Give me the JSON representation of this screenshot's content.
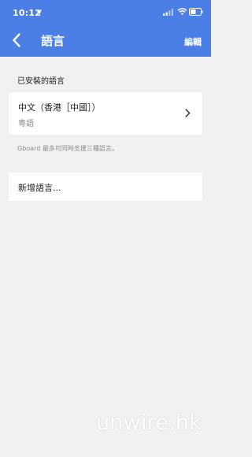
{
  "status_bar": {
    "time": "10:12"
  },
  "header": {
    "title": "語言",
    "edit_label": "編輯",
    "back_icon": "chevron-left-icon",
    "background_color": "#4c7fe6"
  },
  "installed_section": {
    "heading": "已安裝的語言",
    "languages": [
      {
        "name": "中文（香港［中國］）",
        "variant": "粵語"
      }
    ]
  },
  "support_note": "Gboard 最多可同時支援三種語言。",
  "add_language": {
    "label": "新增語言..."
  },
  "watermark": "unwire.hk",
  "colors": {
    "page_background": "#f1f1f1",
    "card_background": "#ffffff",
    "primary_text": "#222222",
    "secondary_text": "#8a8a8a"
  }
}
